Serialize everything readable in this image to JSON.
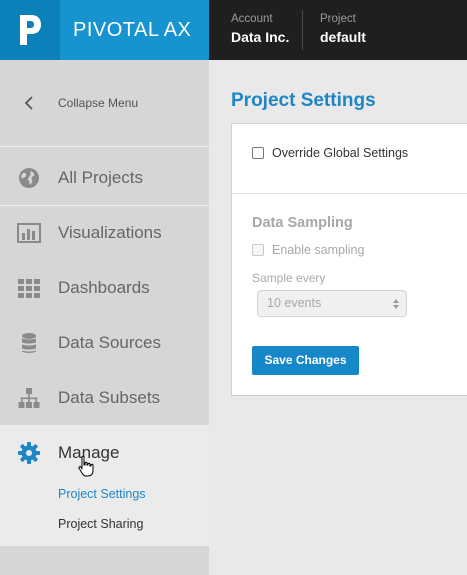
{
  "brand": {
    "logo_letter": "P",
    "name": "PIVOTAL AX"
  },
  "header": {
    "account": {
      "label": "Account",
      "value": "Data Inc."
    },
    "project": {
      "label": "Project",
      "value": "default"
    }
  },
  "sidebar": {
    "collapse_label": "Collapse Menu",
    "items": [
      {
        "label": "All Projects",
        "icon": "globe-icon"
      },
      {
        "label": "Visualizations",
        "icon": "bar-chart-icon"
      },
      {
        "label": "Dashboards",
        "icon": "grid-icon"
      },
      {
        "label": "Data Sources",
        "icon": "database-icon"
      },
      {
        "label": "Data Subsets",
        "icon": "hierarchy-icon"
      }
    ],
    "manage": {
      "label": "Manage",
      "icon": "gear-icon",
      "subitems": [
        {
          "label": "Project Settings",
          "active": true
        },
        {
          "label": "Project Sharing",
          "active": false
        }
      ]
    }
  },
  "main": {
    "title": "Project Settings",
    "override_label": "Override Global Settings",
    "override_checked": false,
    "sampling": {
      "title": "Data Sampling",
      "enable_label": "Enable sampling",
      "enable_checked": false,
      "sample_every_label": "Sample every",
      "sample_every_value": "10 events"
    },
    "save_label": "Save Changes"
  },
  "colors": {
    "brand_blue": "#1794cf",
    "accent_blue": "#1f86c6",
    "topbar": "#1f1f1f",
    "sidebar_bg": "#d6d6d6"
  }
}
